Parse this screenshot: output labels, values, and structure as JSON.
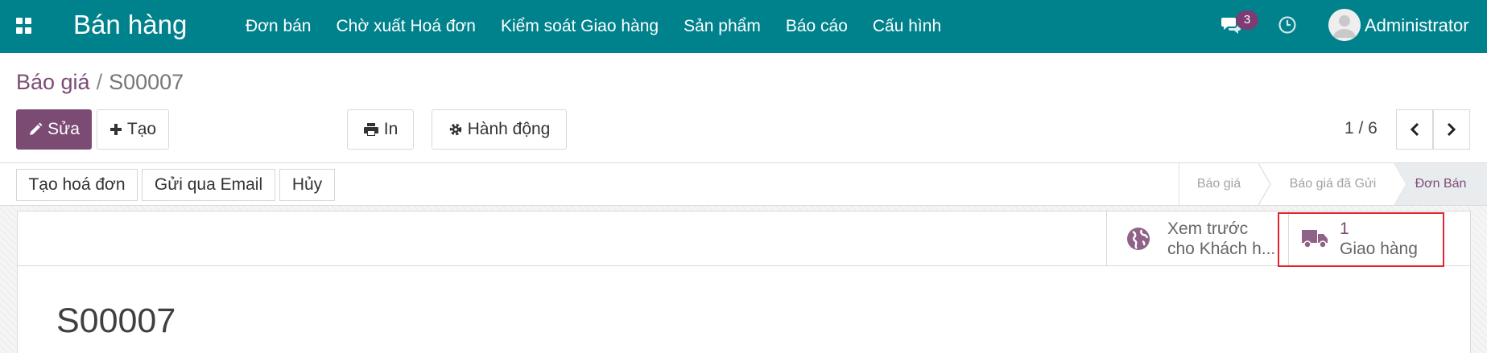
{
  "navbar": {
    "app_title": "Bán hàng",
    "menu": [
      "Đơn bán",
      "Chờ xuất Hoá đơn",
      "Kiểm soát Giao hàng",
      "Sản phẩm",
      "Báo cáo",
      "Cấu hình"
    ],
    "messages_count": "3",
    "user_name": "Administrator",
    "color": "#00828c"
  },
  "breadcrumb": {
    "parent": "Báo giá",
    "separator": "/",
    "current": "S00007"
  },
  "toolbar": {
    "edit_label": "Sửa",
    "create_label": "Tạo",
    "print_label": "In",
    "action_label": "Hành động",
    "pager": "1 / 6"
  },
  "statusbar": {
    "invoice_label": "Tạo hoá đơn",
    "email_label": "Gửi qua Email",
    "cancel_label": "Hủy",
    "stages": [
      "Báo giá",
      "Báo giá đã Gửi",
      "Đơn Bán"
    ],
    "active_stage": "Đơn Bán"
  },
  "sheet": {
    "preview_line1": "Xem trước",
    "preview_line2": "cho Khách h...",
    "delivery_count": "1",
    "delivery_label": "Giao hàng",
    "record_name": "S00007"
  },
  "colors": {
    "brand": "#7c4b74",
    "highlight": "#e0252f"
  },
  "icons": [
    "apps-icon",
    "chat-icon",
    "clock-icon",
    "avatar-icon",
    "pencil-icon",
    "plus-icon",
    "print-icon",
    "gear-icon",
    "chevron-left-icon",
    "chevron-right-icon",
    "globe-icon",
    "truck-icon"
  ]
}
